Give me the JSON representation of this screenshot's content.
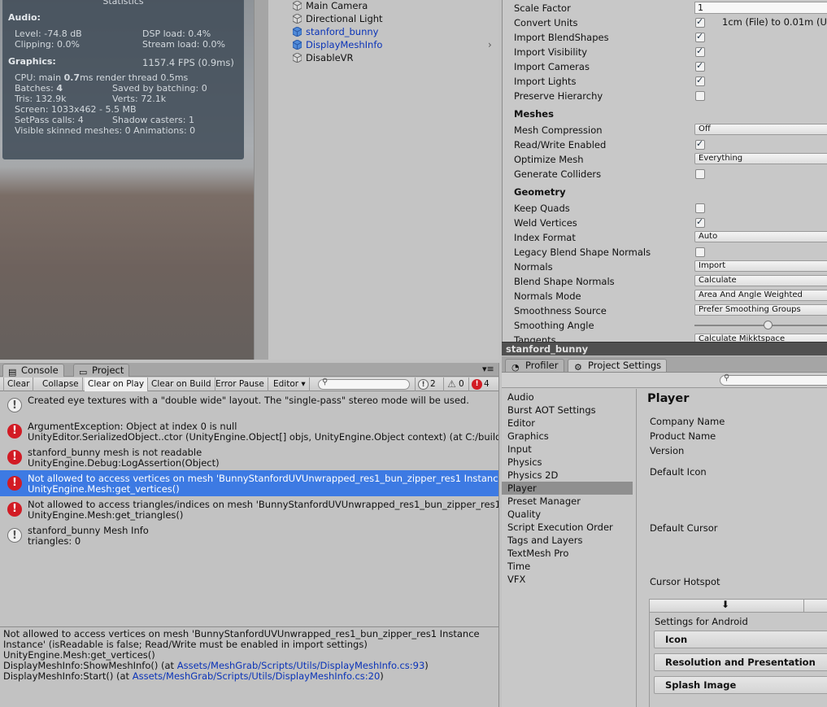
{
  "stats": {
    "title": "Statistics",
    "audio_header": "Audio:",
    "level": "Level: -74.8 dB",
    "clipping": "Clipping: 0.0%",
    "dsp": "DSP load: 0.4%",
    "stream": "Stream load: 0.0%",
    "graphics_header": "Graphics:",
    "fps": "1157.4 FPS (0.9ms)",
    "cpu_a": "CPU: main ",
    "cpu_b": "0.7",
    "cpu_c": "ms  render thread 0.5ms",
    "batches_a": "Batches: ",
    "batches_b": "4",
    "saved": "Saved by batching: 0",
    "tris": "Tris: 132.9k",
    "verts": "Verts: 72.1k",
    "screen": "Screen: 1033x462 - 5.5 MB",
    "setpass": "SetPass calls: 4",
    "shadow": "Shadow casters: 1",
    "skinned": "Visible skinned meshes: 0  Animations: 0"
  },
  "hierarchy": {
    "items": [
      {
        "label": "Main Camera"
      },
      {
        "label": "Directional Light"
      },
      {
        "label": "stanford_bunny"
      },
      {
        "label": "DisplayMeshInfo"
      },
      {
        "label": "DisableVR"
      }
    ],
    "expand_arrow": "›"
  },
  "inspector": {
    "scale_factor_label": "Scale Factor",
    "scale_factor_value": "1",
    "convert_units_label": "Convert Units",
    "convert_units_text": "1cm (File) to 0.01m (U",
    "import_blendshapes": "Import BlendShapes",
    "import_visibility": "Import Visibility",
    "import_cameras": "Import Cameras",
    "import_lights": "Import Lights",
    "preserve_hierarchy": "Preserve Hierarchy",
    "meshes_header": "Meshes",
    "mesh_compression": "Mesh Compression",
    "mesh_compression_value": "Off",
    "read_write": "Read/Write Enabled",
    "optimize_mesh": "Optimize Mesh",
    "optimize_mesh_value": "Everything",
    "generate_colliders": "Generate Colliders",
    "geometry_header": "Geometry",
    "keep_quads": "Keep Quads",
    "weld_vertices": "Weld Vertices",
    "index_format": "Index Format",
    "index_format_value": "Auto",
    "legacy_blend": "Legacy Blend Shape Normals",
    "normals": "Normals",
    "normals_value": "Import",
    "blend_normals": "Blend Shape Normals",
    "blend_normals_value": "Calculate",
    "normals_mode": "Normals Mode",
    "normals_mode_value": "Area And Angle Weighted",
    "smoothness_source": "Smoothness Source",
    "smoothness_source_value": "Prefer Smoothing Groups",
    "smoothing_angle": "Smoothing Angle",
    "smoothing_angle_level": 0.53,
    "tangents": "Tangents",
    "tangents_value": "Calculate Mikktspace",
    "footer_title": "stanford_bunny",
    "checked_color": "#234"
  },
  "console": {
    "tabs": [
      {
        "label": "Console"
      },
      {
        "label": "Project"
      }
    ],
    "toolbar": {
      "clear": "Clear",
      "collapse": "Collapse",
      "clear_on_play": "Clear on Play",
      "clear_on_build": "Clear on Build",
      "error_pause": "Error Pause",
      "editor": "Editor ▾",
      "count_info": "2",
      "count_warn": "0",
      "count_err": "4"
    },
    "menu_icon": "▾≡",
    "logs": [
      {
        "type": "info",
        "line1": "Created eye textures with a \"double wide\" layout.  The \"single-pass\" stereo mode will be used.",
        "line2": ""
      },
      {
        "type": "error",
        "line1": "ArgumentException: Object at index 0 is null",
        "line2": "UnityEditor.SerializedObject..ctor (UnityEngine.Object[] objs, UnityEngine.Object context) (at C:/build"
      },
      {
        "type": "error",
        "line1": "stanford_bunny mesh is not readable",
        "line2": "UnityEngine.Debug:LogAssertion(Object)"
      },
      {
        "type": "error",
        "line1": "Not allowed to access vertices on mesh 'BunnyStanfordUVUnwrapped_res1_bun_zipper_res1 Instance",
        "line2": "UnityEngine.Mesh:get_vertices()"
      },
      {
        "type": "error",
        "line1": "Not allowed to access triangles/indices on mesh 'BunnyStanfordUVUnwrapped_res1_bun_zipper_res1",
        "line2": "UnityEngine.Mesh:get_triangles()"
      },
      {
        "type": "info",
        "line1": "stanford_bunny Mesh Info",
        "line2": "triangles: 0"
      }
    ],
    "detail": {
      "l1": "Not allowed to access vertices on mesh 'BunnyStanfordUVUnwrapped_res1_bun_zipper_res1 Instance",
      "l2": "Instance' (isReadable is false; Read/Write must be enabled in import settings)",
      "l3": "UnityEngine.Mesh:get_vertices()",
      "l4a": "DisplayMeshInfo:ShowMeshInfo() (at ",
      "l4link": "Assets/MeshGrab/Scripts/Utils/DisplayMeshInfo.cs:93",
      "l4b": ")",
      "l5a": "DisplayMeshInfo:Start() (at ",
      "l5link": "Assets/MeshGrab/Scripts/Utils/DisplayMeshInfo.cs:20",
      "l5b": ")"
    }
  },
  "project_settings": {
    "tabs": [
      {
        "label": "Profiler"
      },
      {
        "label": "Project Settings"
      }
    ],
    "categories": [
      "Audio",
      "Burst AOT Settings",
      "Editor",
      "Graphics",
      "Input",
      "Physics",
      "Physics 2D",
      "Player",
      "Preset Manager",
      "Quality",
      "Script Execution Order",
      "Tags and Layers",
      "TextMesh Pro",
      "Time",
      "VFX"
    ],
    "selected_category": "Player",
    "title": "Player",
    "company_name": "Company Name",
    "product_name": "Product Name",
    "version": "Version",
    "default_icon": "Default Icon",
    "default_cursor": "Default Cursor",
    "cursor_hotspot": "Cursor Hotspot",
    "platform_icon": "⬇",
    "settings_for": "Settings for Android",
    "sections": [
      "Icon",
      "Resolution and Presentation",
      "Splash Image"
    ],
    "selection_color": "#3d7ae3",
    "error_color": "#d21b24"
  }
}
